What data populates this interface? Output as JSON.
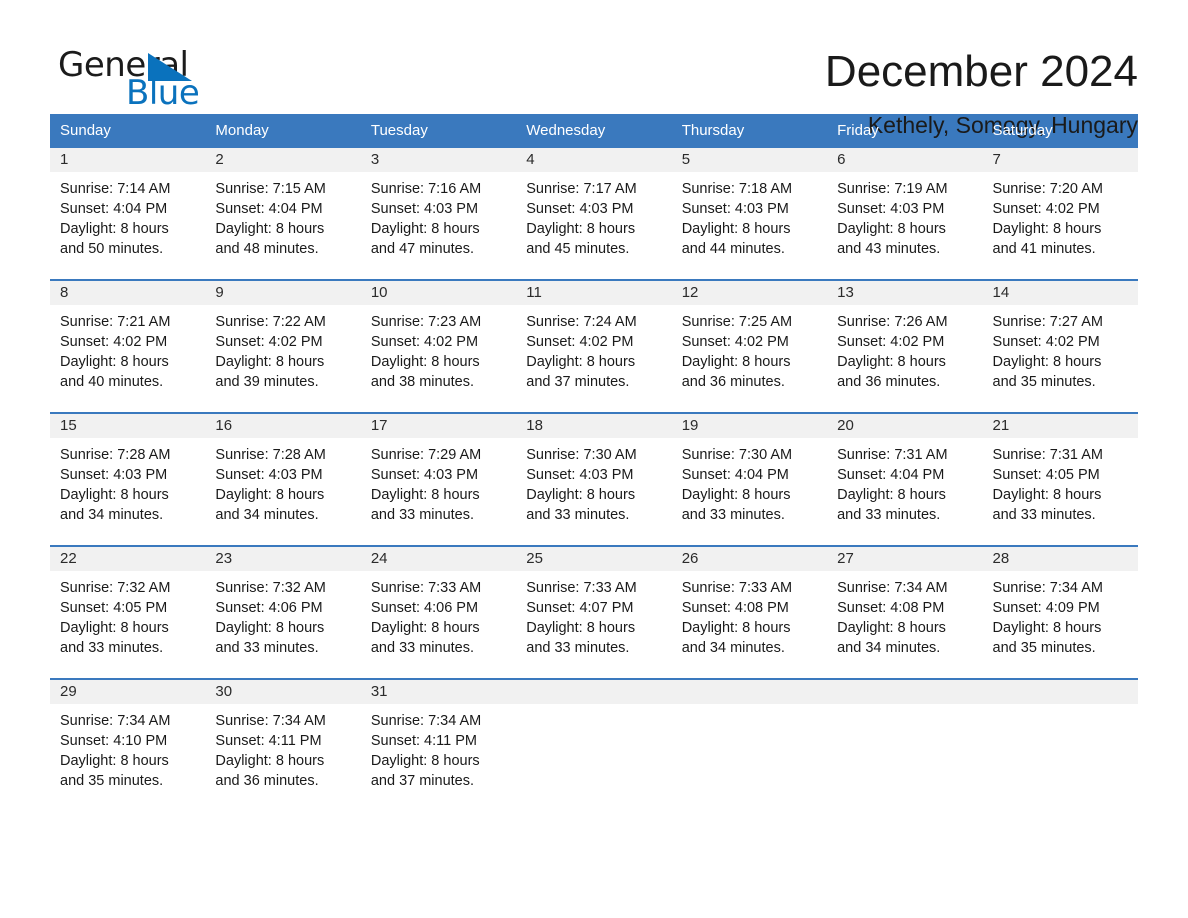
{
  "brand": {
    "name_part1": "General",
    "name_part2": "Blue",
    "triangle_color": "#0a72bd"
  },
  "header": {
    "month_title": "December 2024",
    "location": "Kethely, Somogy, Hungary"
  },
  "colors": {
    "header_blue": "#3a79be",
    "daynum_band": "#f1f1f1",
    "text": "#1a1a1a",
    "brand_blue": "#0a72bd"
  },
  "weekday_headers": [
    "Sunday",
    "Monday",
    "Tuesday",
    "Wednesday",
    "Thursday",
    "Friday",
    "Saturday"
  ],
  "weeks": [
    [
      {
        "day": "1",
        "sunrise": "Sunrise: 7:14 AM",
        "sunset": "Sunset: 4:04 PM",
        "daylight1": "Daylight: 8 hours",
        "daylight2": "and 50 minutes."
      },
      {
        "day": "2",
        "sunrise": "Sunrise: 7:15 AM",
        "sunset": "Sunset: 4:04 PM",
        "daylight1": "Daylight: 8 hours",
        "daylight2": "and 48 minutes."
      },
      {
        "day": "3",
        "sunrise": "Sunrise: 7:16 AM",
        "sunset": "Sunset: 4:03 PM",
        "daylight1": "Daylight: 8 hours",
        "daylight2": "and 47 minutes."
      },
      {
        "day": "4",
        "sunrise": "Sunrise: 7:17 AM",
        "sunset": "Sunset: 4:03 PM",
        "daylight1": "Daylight: 8 hours",
        "daylight2": "and 45 minutes."
      },
      {
        "day": "5",
        "sunrise": "Sunrise: 7:18 AM",
        "sunset": "Sunset: 4:03 PM",
        "daylight1": "Daylight: 8 hours",
        "daylight2": "and 44 minutes."
      },
      {
        "day": "6",
        "sunrise": "Sunrise: 7:19 AM",
        "sunset": "Sunset: 4:03 PM",
        "daylight1": "Daylight: 8 hours",
        "daylight2": "and 43 minutes."
      },
      {
        "day": "7",
        "sunrise": "Sunrise: 7:20 AM",
        "sunset": "Sunset: 4:02 PM",
        "daylight1": "Daylight: 8 hours",
        "daylight2": "and 41 minutes."
      }
    ],
    [
      {
        "day": "8",
        "sunrise": "Sunrise: 7:21 AM",
        "sunset": "Sunset: 4:02 PM",
        "daylight1": "Daylight: 8 hours",
        "daylight2": "and 40 minutes."
      },
      {
        "day": "9",
        "sunrise": "Sunrise: 7:22 AM",
        "sunset": "Sunset: 4:02 PM",
        "daylight1": "Daylight: 8 hours",
        "daylight2": "and 39 minutes."
      },
      {
        "day": "10",
        "sunrise": "Sunrise: 7:23 AM",
        "sunset": "Sunset: 4:02 PM",
        "daylight1": "Daylight: 8 hours",
        "daylight2": "and 38 minutes."
      },
      {
        "day": "11",
        "sunrise": "Sunrise: 7:24 AM",
        "sunset": "Sunset: 4:02 PM",
        "daylight1": "Daylight: 8 hours",
        "daylight2": "and 37 minutes."
      },
      {
        "day": "12",
        "sunrise": "Sunrise: 7:25 AM",
        "sunset": "Sunset: 4:02 PM",
        "daylight1": "Daylight: 8 hours",
        "daylight2": "and 36 minutes."
      },
      {
        "day": "13",
        "sunrise": "Sunrise: 7:26 AM",
        "sunset": "Sunset: 4:02 PM",
        "daylight1": "Daylight: 8 hours",
        "daylight2": "and 36 minutes."
      },
      {
        "day": "14",
        "sunrise": "Sunrise: 7:27 AM",
        "sunset": "Sunset: 4:02 PM",
        "daylight1": "Daylight: 8 hours",
        "daylight2": "and 35 minutes."
      }
    ],
    [
      {
        "day": "15",
        "sunrise": "Sunrise: 7:28 AM",
        "sunset": "Sunset: 4:03 PM",
        "daylight1": "Daylight: 8 hours",
        "daylight2": "and 34 minutes."
      },
      {
        "day": "16",
        "sunrise": "Sunrise: 7:28 AM",
        "sunset": "Sunset: 4:03 PM",
        "daylight1": "Daylight: 8 hours",
        "daylight2": "and 34 minutes."
      },
      {
        "day": "17",
        "sunrise": "Sunrise: 7:29 AM",
        "sunset": "Sunset: 4:03 PM",
        "daylight1": "Daylight: 8 hours",
        "daylight2": "and 33 minutes."
      },
      {
        "day": "18",
        "sunrise": "Sunrise: 7:30 AM",
        "sunset": "Sunset: 4:03 PM",
        "daylight1": "Daylight: 8 hours",
        "daylight2": "and 33 minutes."
      },
      {
        "day": "19",
        "sunrise": "Sunrise: 7:30 AM",
        "sunset": "Sunset: 4:04 PM",
        "daylight1": "Daylight: 8 hours",
        "daylight2": "and 33 minutes."
      },
      {
        "day": "20",
        "sunrise": "Sunrise: 7:31 AM",
        "sunset": "Sunset: 4:04 PM",
        "daylight1": "Daylight: 8 hours",
        "daylight2": "and 33 minutes."
      },
      {
        "day": "21",
        "sunrise": "Sunrise: 7:31 AM",
        "sunset": "Sunset: 4:05 PM",
        "daylight1": "Daylight: 8 hours",
        "daylight2": "and 33 minutes."
      }
    ],
    [
      {
        "day": "22",
        "sunrise": "Sunrise: 7:32 AM",
        "sunset": "Sunset: 4:05 PM",
        "daylight1": "Daylight: 8 hours",
        "daylight2": "and 33 minutes."
      },
      {
        "day": "23",
        "sunrise": "Sunrise: 7:32 AM",
        "sunset": "Sunset: 4:06 PM",
        "daylight1": "Daylight: 8 hours",
        "daylight2": "and 33 minutes."
      },
      {
        "day": "24",
        "sunrise": "Sunrise: 7:33 AM",
        "sunset": "Sunset: 4:06 PM",
        "daylight1": "Daylight: 8 hours",
        "daylight2": "and 33 minutes."
      },
      {
        "day": "25",
        "sunrise": "Sunrise: 7:33 AM",
        "sunset": "Sunset: 4:07 PM",
        "daylight1": "Daylight: 8 hours",
        "daylight2": "and 33 minutes."
      },
      {
        "day": "26",
        "sunrise": "Sunrise: 7:33 AM",
        "sunset": "Sunset: 4:08 PM",
        "daylight1": "Daylight: 8 hours",
        "daylight2": "and 34 minutes."
      },
      {
        "day": "27",
        "sunrise": "Sunrise: 7:34 AM",
        "sunset": "Sunset: 4:08 PM",
        "daylight1": "Daylight: 8 hours",
        "daylight2": "and 34 minutes."
      },
      {
        "day": "28",
        "sunrise": "Sunrise: 7:34 AM",
        "sunset": "Sunset: 4:09 PM",
        "daylight1": "Daylight: 8 hours",
        "daylight2": "and 35 minutes."
      }
    ],
    [
      {
        "day": "29",
        "sunrise": "Sunrise: 7:34 AM",
        "sunset": "Sunset: 4:10 PM",
        "daylight1": "Daylight: 8 hours",
        "daylight2": "and 35 minutes."
      },
      {
        "day": "30",
        "sunrise": "Sunrise: 7:34 AM",
        "sunset": "Sunset: 4:11 PM",
        "daylight1": "Daylight: 8 hours",
        "daylight2": "and 36 minutes."
      },
      {
        "day": "31",
        "sunrise": "Sunrise: 7:34 AM",
        "sunset": "Sunset: 4:11 PM",
        "daylight1": "Daylight: 8 hours",
        "daylight2": "and 37 minutes."
      },
      {
        "day": "",
        "sunrise": "",
        "sunset": "",
        "daylight1": "",
        "daylight2": ""
      },
      {
        "day": "",
        "sunrise": "",
        "sunset": "",
        "daylight1": "",
        "daylight2": ""
      },
      {
        "day": "",
        "sunrise": "",
        "sunset": "",
        "daylight1": "",
        "daylight2": ""
      },
      {
        "day": "",
        "sunrise": "",
        "sunset": "",
        "daylight1": "",
        "daylight2": ""
      }
    ]
  ]
}
